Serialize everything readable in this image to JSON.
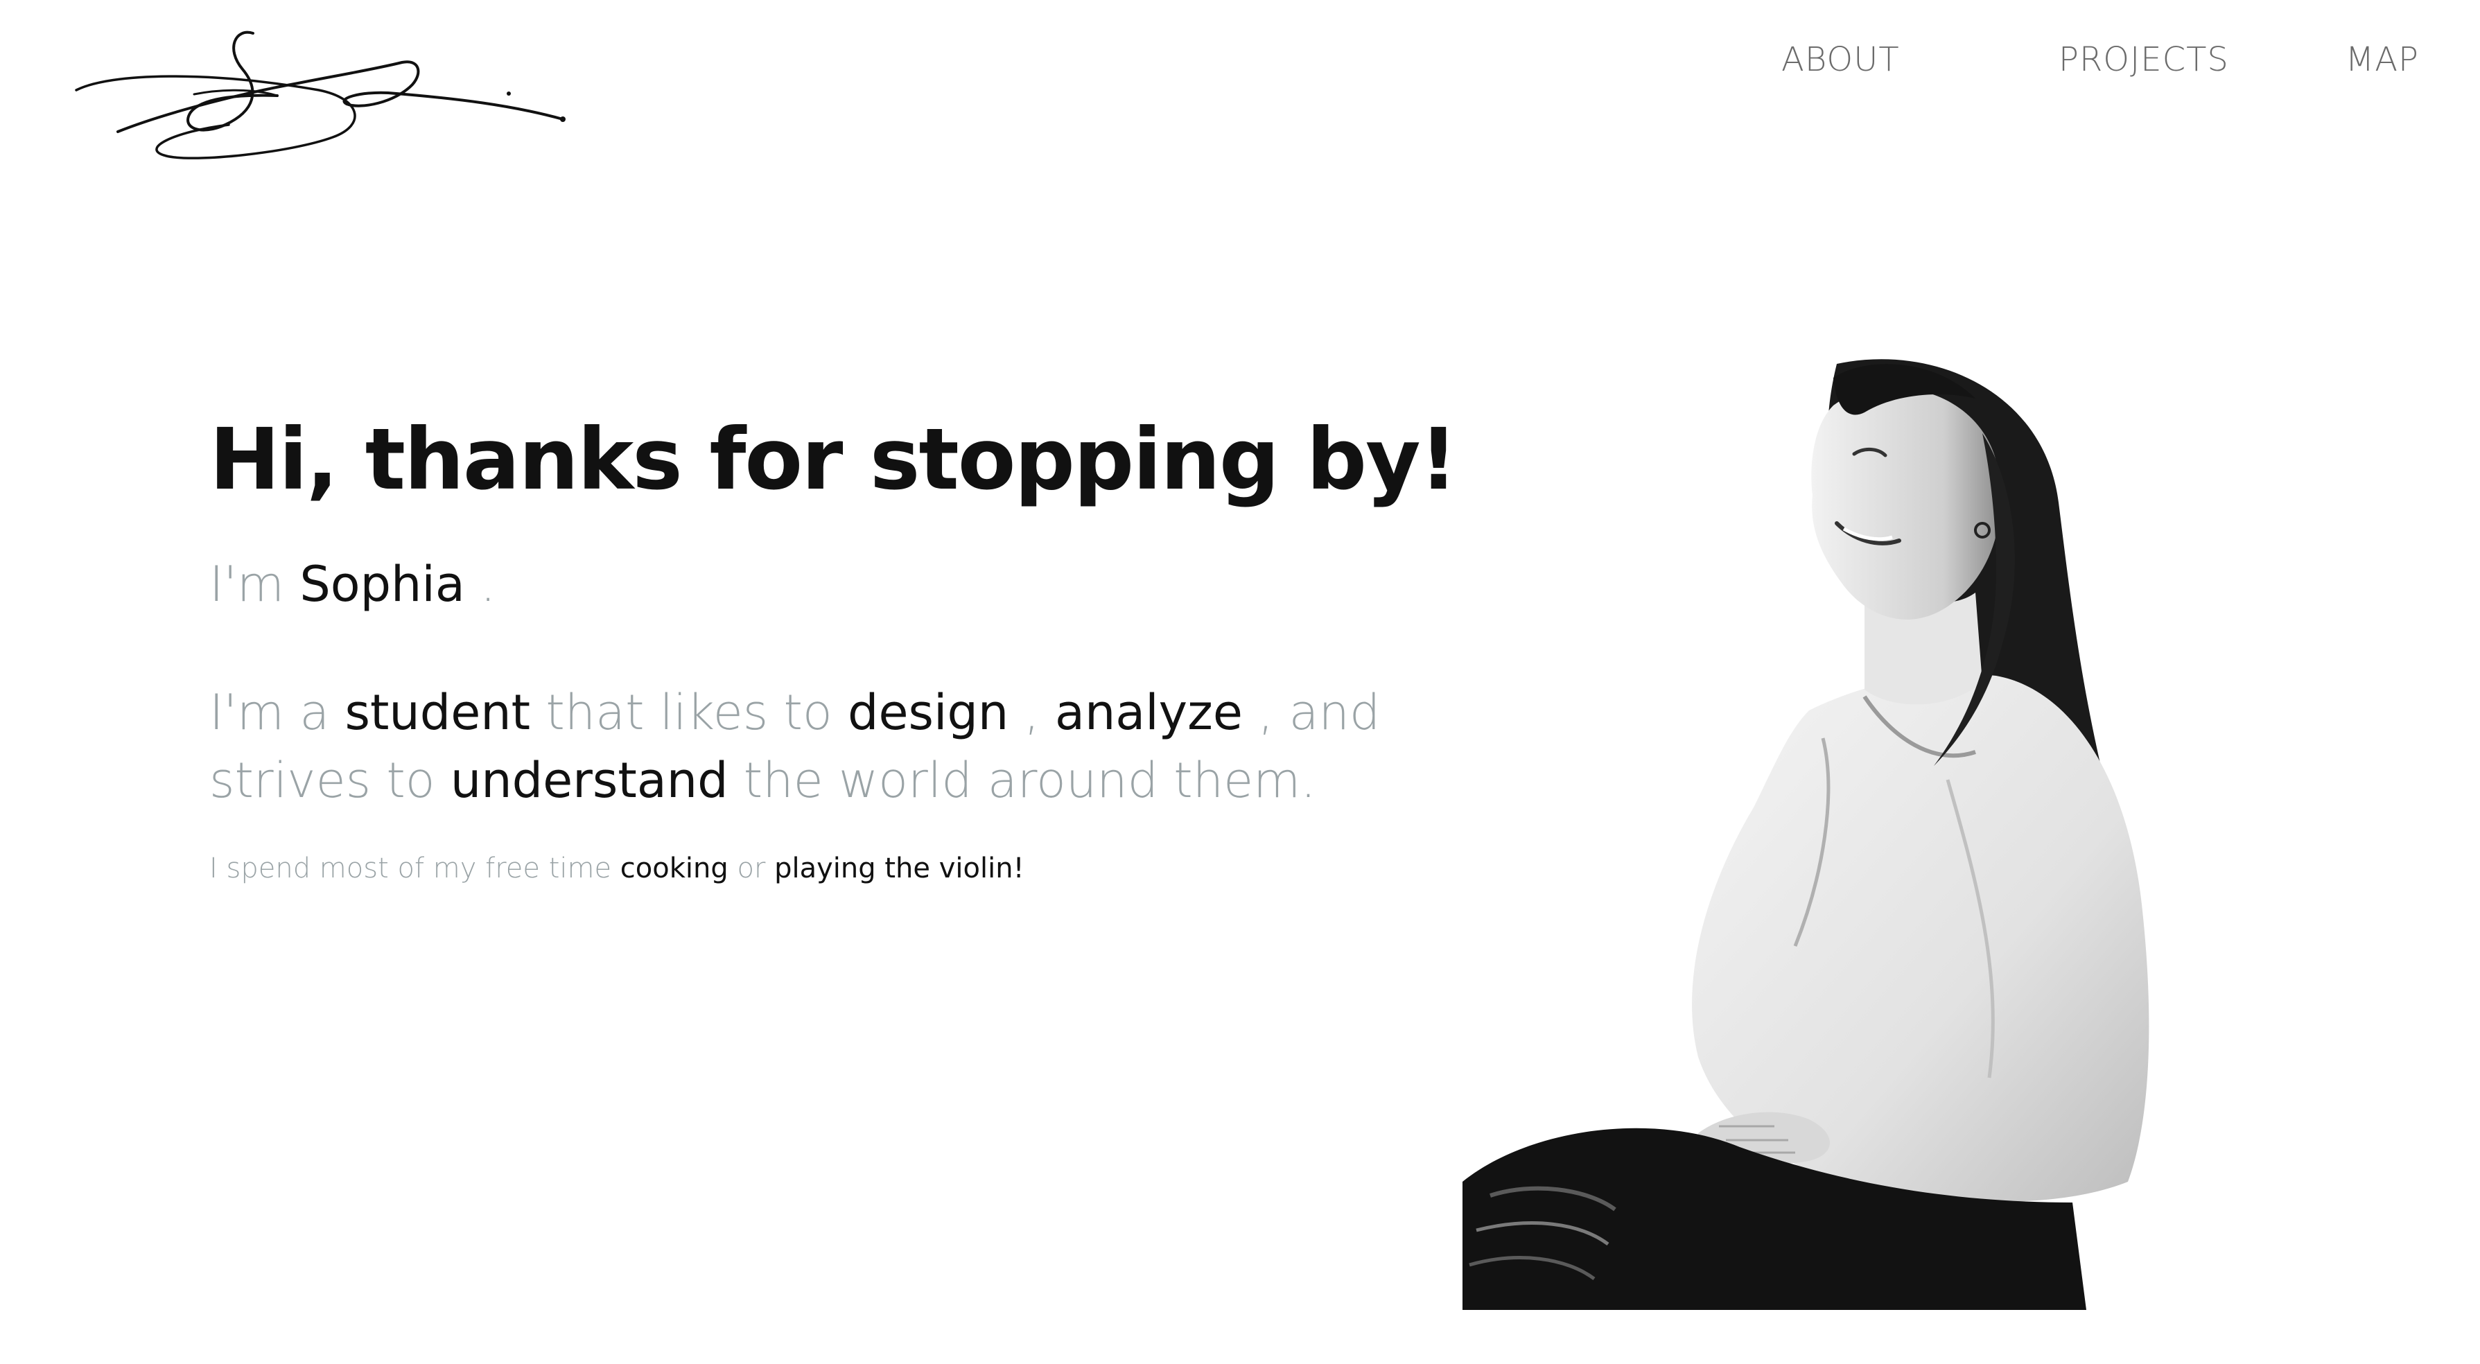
{
  "header": {
    "signature_logo": "signature-logo",
    "nav": [
      {
        "label": "ABOUT"
      },
      {
        "label": "PROJECTS"
      },
      {
        "label": "MAP"
      }
    ]
  },
  "hero": {
    "headline": "Hi, thanks for stopping by!",
    "intro": {
      "prefix": "I'm",
      "name": "Sophia",
      "suffix": "."
    },
    "description": {
      "part1": "I'm a",
      "role": "student",
      "part2": "that likes to",
      "verb1": "design",
      "part3": ",",
      "verb2": "analyze",
      "part4": ", and strives to",
      "verb3": "understand",
      "part5": "the world around them."
    },
    "hobbies": {
      "prefix": "I spend most of my free time",
      "hobby1": "cooking",
      "connector": "or",
      "hobby2": "playing the violin!"
    }
  },
  "portrait": {
    "icon": "portrait-photo"
  },
  "colors": {
    "text_dark": "#111111",
    "text_muted": "#9aa3a6",
    "nav_text": "#6b6b6b",
    "background": "#ffffff"
  }
}
